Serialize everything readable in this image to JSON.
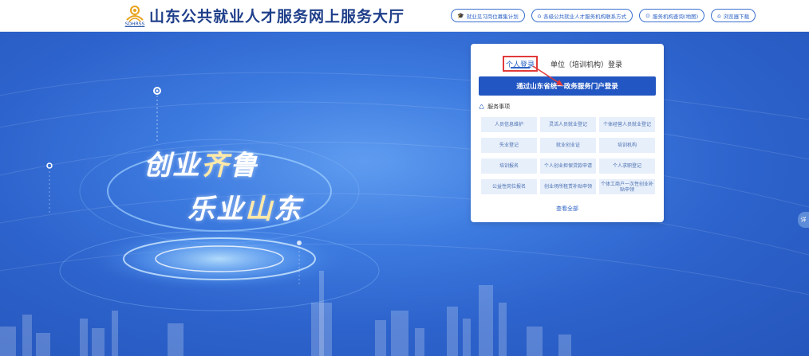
{
  "header": {
    "logo_text": "SDHRSS",
    "title": "山东公共就业人才服务网上服务大厅",
    "links": [
      {
        "icon": "graduation-cap-icon",
        "glyph": "🎓",
        "label": "就业见习岗位募集计划"
      },
      {
        "icon": "home-icon",
        "glyph": "⌂",
        "label": "各级公共就业人才服务机构联系方式"
      },
      {
        "icon": "search-icon",
        "glyph": "⊙",
        "label": "服务机构查询(地图)"
      },
      {
        "icon": "home-icon",
        "glyph": "⌂",
        "label": "浏览器下载"
      }
    ]
  },
  "hero": {
    "slogan_line1_a": "创业",
    "slogan_line1_b": "齐",
    "slogan_line1_c": "鲁",
    "slogan_line2_a": "乐业",
    "slogan_line2_b": "山",
    "slogan_line2_c": "东"
  },
  "login": {
    "tab_personal": "个人登录",
    "tab_unit": "单位（培训机构）登录",
    "login_button": "通过山东省统一政务服务门户登录",
    "services_heading": "服务事项",
    "services": [
      "人员信息维护",
      "灵活人员就业登记",
      "个体经营人员就业登记",
      "失业登记",
      "就业创业证",
      "培训机构",
      "培训报名",
      "个人创业担保贷款申请",
      "个人求职登记",
      "公益性岗位报名",
      "创业场所租赁补贴申领",
      "个体工商户一次性创业补贴申领"
    ],
    "view_all": "查看全部"
  },
  "side_tab": "详",
  "colors": {
    "primary": "#2256c2",
    "highlight_border": "#e23a3a",
    "hero_bg": "#2d63cc",
    "service_bg": "#e7effb"
  }
}
